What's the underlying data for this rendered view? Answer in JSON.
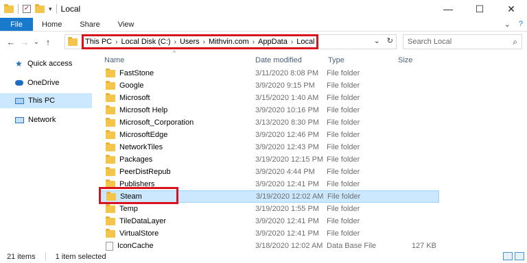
{
  "window": {
    "title": "Local",
    "minimize": "—",
    "maximize": "☐",
    "close": "✕"
  },
  "ribbon": {
    "tabs": [
      "File",
      "Home",
      "Share",
      "View"
    ],
    "collapse": "⌄",
    "help": "?"
  },
  "nav": {
    "back": "←",
    "forward": "→",
    "recent": "⌄",
    "up": "↑"
  },
  "address": {
    "crumbs": [
      "This PC",
      "Local Disk (C:)",
      "Users",
      "Mithvin.com",
      "AppData",
      "Local"
    ],
    "dropdown": "⌄",
    "refresh": "↻"
  },
  "search": {
    "placeholder": "Search Local"
  },
  "sidebar": {
    "items": [
      {
        "label": "Quick access",
        "icon": "star-icon"
      },
      {
        "label": "OneDrive",
        "icon": "cloud-icon"
      },
      {
        "label": "This PC",
        "icon": "computer-icon"
      },
      {
        "label": "Network",
        "icon": "network-icon"
      }
    ],
    "selected": "This PC"
  },
  "columns": {
    "name": "Name",
    "date": "Date modified",
    "type": "Type",
    "size": "Size"
  },
  "files": [
    {
      "name": "FastStone",
      "date": "3/11/2020 8:08 PM",
      "type": "File folder",
      "size": ""
    },
    {
      "name": "Google",
      "date": "3/9/2020 9:15 PM",
      "type": "File folder",
      "size": ""
    },
    {
      "name": "Microsoft",
      "date": "3/15/2020 1:40 AM",
      "type": "File folder",
      "size": ""
    },
    {
      "name": "Microsoft Help",
      "date": "3/9/2020 10:16 PM",
      "type": "File folder",
      "size": ""
    },
    {
      "name": "Microsoft_Corporation",
      "date": "3/13/2020 8:30 PM",
      "type": "File folder",
      "size": ""
    },
    {
      "name": "MicrosoftEdge",
      "date": "3/9/2020 12:46 PM",
      "type": "File folder",
      "size": ""
    },
    {
      "name": "NetworkTiles",
      "date": "3/9/2020 12:43 PM",
      "type": "File folder",
      "size": ""
    },
    {
      "name": "Packages",
      "date": "3/19/2020 12:15 PM",
      "type": "File folder",
      "size": ""
    },
    {
      "name": "PeerDistRepub",
      "date": "3/9/2020 4:44 PM",
      "type": "File folder",
      "size": ""
    },
    {
      "name": "Publishers",
      "date": "3/9/2020 12:41 PM",
      "type": "File folder",
      "size": ""
    },
    {
      "name": "Steam",
      "date": "3/19/2020 12:02 AM",
      "type": "File folder",
      "size": "",
      "selected": true
    },
    {
      "name": "Temp",
      "date": "3/19/2020 1:55 PM",
      "type": "File folder",
      "size": ""
    },
    {
      "name": "TileDataLayer",
      "date": "3/9/2020 12:41 PM",
      "type": "File folder",
      "size": ""
    },
    {
      "name": "VirtualStore",
      "date": "3/9/2020 12:41 PM",
      "type": "File folder",
      "size": ""
    },
    {
      "name": "IconCache",
      "date": "3/18/2020 12:02 AM",
      "type": "Data Base File",
      "size": "127 KB"
    }
  ],
  "status": {
    "count": "21 items",
    "selected": "1 item selected"
  },
  "colors": {
    "file_tab": "#1979ca",
    "selection": "#cce8ff",
    "highlight_box": "#d9121e",
    "folder": "#f3c64b"
  }
}
